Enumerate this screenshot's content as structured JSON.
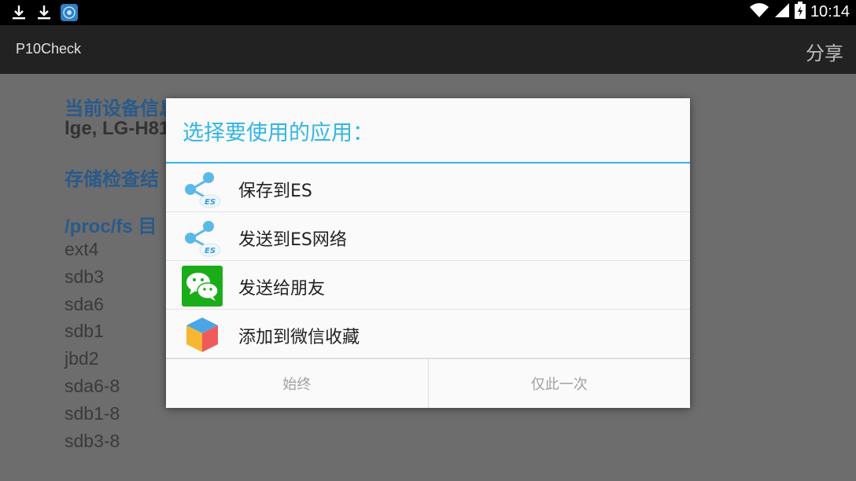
{
  "status_bar": {
    "time": "10:14",
    "icons": [
      "download-icon",
      "download-icon",
      "app-notification-icon",
      "wifi-icon",
      "signal-icon",
      "battery-charging-icon"
    ]
  },
  "action_bar": {
    "title": "P10Check",
    "share_label": "分享"
  },
  "content": {
    "device_heading": "当前设备信息",
    "device_value": "lge, LG-H81",
    "storage_heading": "存储检查结",
    "procfs_heading": "/proc/fs 目",
    "procfs_items": [
      "ext4",
      "sdb3",
      "sda6",
      "sdb1",
      "jbd2",
      "sda6-8",
      "sdb1-8",
      "sdb3-8"
    ]
  },
  "dialog": {
    "title": "选择要使用的应用：",
    "items": [
      {
        "label": "保存到ES",
        "icon": "es-share-icon"
      },
      {
        "label": "发送到ES网络",
        "icon": "es-share-icon"
      },
      {
        "label": "发送给朋友",
        "icon": "wechat-icon"
      },
      {
        "label": "添加到微信收藏",
        "icon": "wechat-favorites-cube-icon"
      }
    ],
    "buttons": {
      "always": "始终",
      "just_once": "仅此一次"
    }
  },
  "colors": {
    "accent": "#33b5e5",
    "wechat_green": "#1aad19",
    "status_bar": "#000000",
    "action_bar": "#222222"
  }
}
